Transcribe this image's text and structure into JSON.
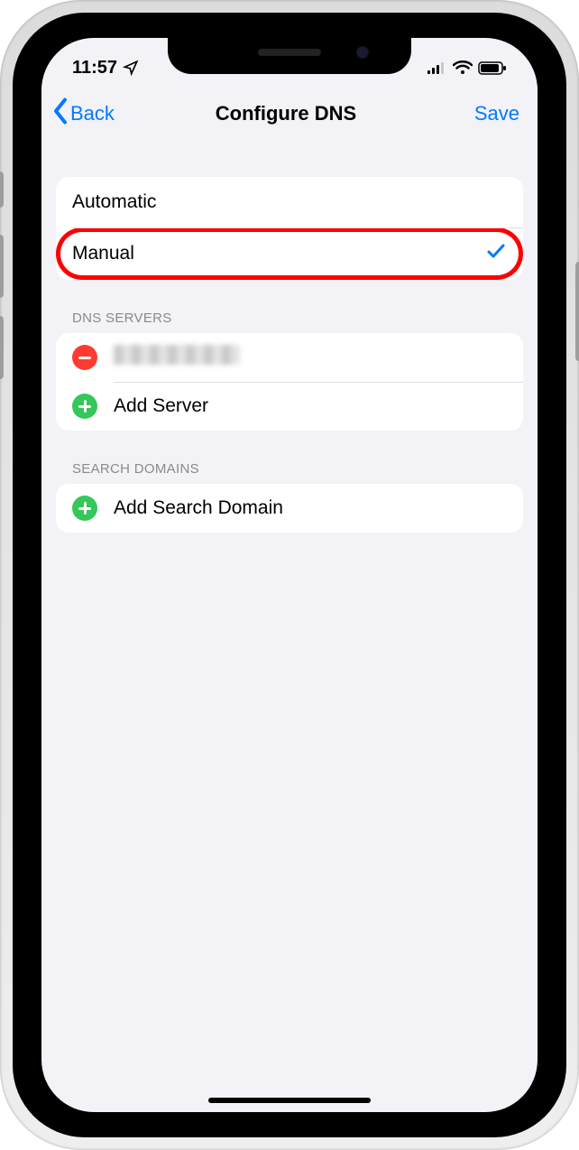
{
  "statusbar": {
    "time": "11:57"
  },
  "nav": {
    "back_label": "Back",
    "title": "Configure DNS",
    "save_label": "Save"
  },
  "dns_mode": {
    "options": [
      {
        "label": "Automatic",
        "selected": false
      },
      {
        "label": "Manual",
        "selected": true
      }
    ]
  },
  "dns_servers": {
    "header": "DNS SERVERS",
    "items": [
      {
        "label": "",
        "redacted": true
      }
    ],
    "add_label": "Add Server"
  },
  "search_domains": {
    "header": "SEARCH DOMAINS",
    "add_label": "Add Search Domain"
  },
  "colors": {
    "tint": "#007aff",
    "destructive": "#ff3b30",
    "add": "#34c759",
    "highlight": "#ff0000"
  }
}
